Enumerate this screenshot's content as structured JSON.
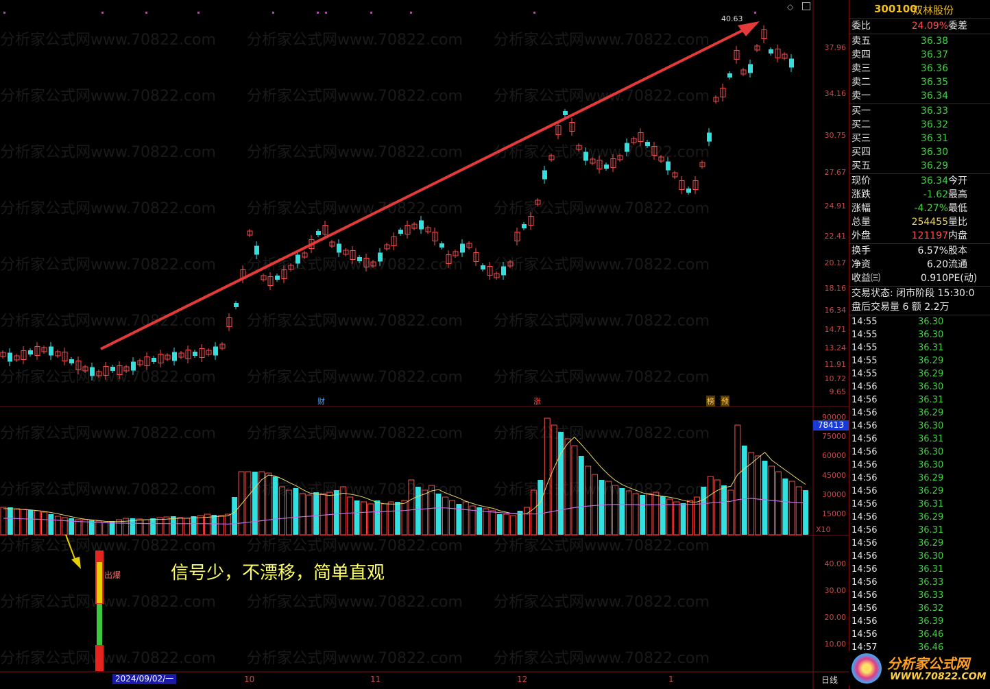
{
  "stock": {
    "code": "300100",
    "name": "双林股份"
  },
  "watermark": "分析家公式网www.70822.com",
  "caption": "信号少，不漂移，简单直观",
  "signal_label": "出爆",
  "price_peak_label": "40.63",
  "price_axis": [
    "37.96",
    "34.16",
    "30.75",
    "27.67",
    "24.91",
    "22.41",
    "20.17",
    "18.16",
    "16.34",
    "14.71",
    "13.24",
    "11.91",
    "10.72",
    "9.65"
  ],
  "volume_axis": [
    "90000",
    "75000",
    "60000",
    "45000",
    "30000",
    "15000"
  ],
  "volume_current": "78413",
  "volume_unit": "X10",
  "indicator_axis": [
    "40.00",
    "30.00",
    "20.00",
    "10.00"
  ],
  "date_tag": "2024/09/02/一",
  "months": [
    "10",
    "11",
    "12",
    "1"
  ],
  "events": [
    {
      "text": "财",
      "color": "#4aa3ff"
    },
    {
      "text": "涨",
      "color": "#ff5555"
    },
    {
      "text": "榜",
      "color": "#d4a017"
    },
    {
      "text": "预",
      "color": "#d4a017"
    }
  ],
  "period_label": "日线",
  "quote": {
    "weibi_label": "委比",
    "weibi_value": "24.09%",
    "weicha_label": "委差",
    "asks": [
      {
        "label": "卖五",
        "price": "36.38"
      },
      {
        "label": "卖四",
        "price": "36.37"
      },
      {
        "label": "卖三",
        "price": "36.36"
      },
      {
        "label": "卖二",
        "price": "36.35"
      },
      {
        "label": "卖一",
        "price": "36.34"
      }
    ],
    "bids": [
      {
        "label": "买一",
        "price": "36.33"
      },
      {
        "label": "买二",
        "price": "36.32"
      },
      {
        "label": "买三",
        "price": "36.31"
      },
      {
        "label": "买四",
        "price": "36.30"
      },
      {
        "label": "买五",
        "price": "36.29"
      }
    ],
    "stats": [
      {
        "label": "现价",
        "value": "36.34",
        "right": "今开",
        "color": "green"
      },
      {
        "label": "涨跌",
        "value": "-1.62",
        "right": "最高",
        "color": "green"
      },
      {
        "label": "涨幅",
        "value": "-4.27%",
        "right": "最低",
        "color": "green"
      },
      {
        "label": "总量",
        "value": "254455",
        "right": "量比",
        "color": "yellow"
      },
      {
        "label": "外盘",
        "value": "121197",
        "right": "内盘",
        "color": "red"
      }
    ],
    "stats2": [
      {
        "label": "换手",
        "value": "6.57%",
        "right": "股本"
      },
      {
        "label": "净资",
        "value": "6.20",
        "right": "流通"
      },
      {
        "label": "收益㈢",
        "value": "0.910",
        "right": "PE(动)"
      }
    ],
    "trade_status": "交易状态: 闭市阶段 15:30:0",
    "after_hours": "盘后交易量 6 额 2.2万"
  },
  "ticks": [
    {
      "t": "14:55",
      "p": "36.30"
    },
    {
      "t": "14:55",
      "p": "36.30"
    },
    {
      "t": "14:55",
      "p": "36.31"
    },
    {
      "t": "14:55",
      "p": "36.29"
    },
    {
      "t": "14:55",
      "p": "36.29"
    },
    {
      "t": "14:56",
      "p": "36.30"
    },
    {
      "t": "14:56",
      "p": "36.31"
    },
    {
      "t": "14:56",
      "p": "36.29"
    },
    {
      "t": "14:56",
      "p": "36.30"
    },
    {
      "t": "14:56",
      "p": "36.31"
    },
    {
      "t": "14:56",
      "p": "36.30"
    },
    {
      "t": "14:56",
      "p": "36.30"
    },
    {
      "t": "14:56",
      "p": "36.29"
    },
    {
      "t": "14:56",
      "p": "36.29"
    },
    {
      "t": "14:56",
      "p": "36.31"
    },
    {
      "t": "14:56",
      "p": "36.29"
    },
    {
      "t": "14:56",
      "p": "36.31"
    },
    {
      "t": "14:56",
      "p": "36.29"
    },
    {
      "t": "14:56",
      "p": "36.30"
    },
    {
      "t": "14:56",
      "p": "36.31"
    },
    {
      "t": "14:56",
      "p": "36.33"
    },
    {
      "t": "14:56",
      "p": "36.33"
    },
    {
      "t": "14:56",
      "p": "36.32"
    },
    {
      "t": "14:56",
      "p": "36.39"
    },
    {
      "t": "14:56",
      "p": "36.46"
    },
    {
      "t": "14:57",
      "p": "36.46"
    }
  ],
  "logo": {
    "title": "分析家公式网",
    "url": "WWW.70822.COM"
  },
  "colors": {
    "up": "#ff4b4b",
    "down": "#33e0e0",
    "ma5": "#e6d56a",
    "ma10": "#c070e0",
    "grid": "#7a1010",
    "arrow": "#e53a3a"
  }
}
